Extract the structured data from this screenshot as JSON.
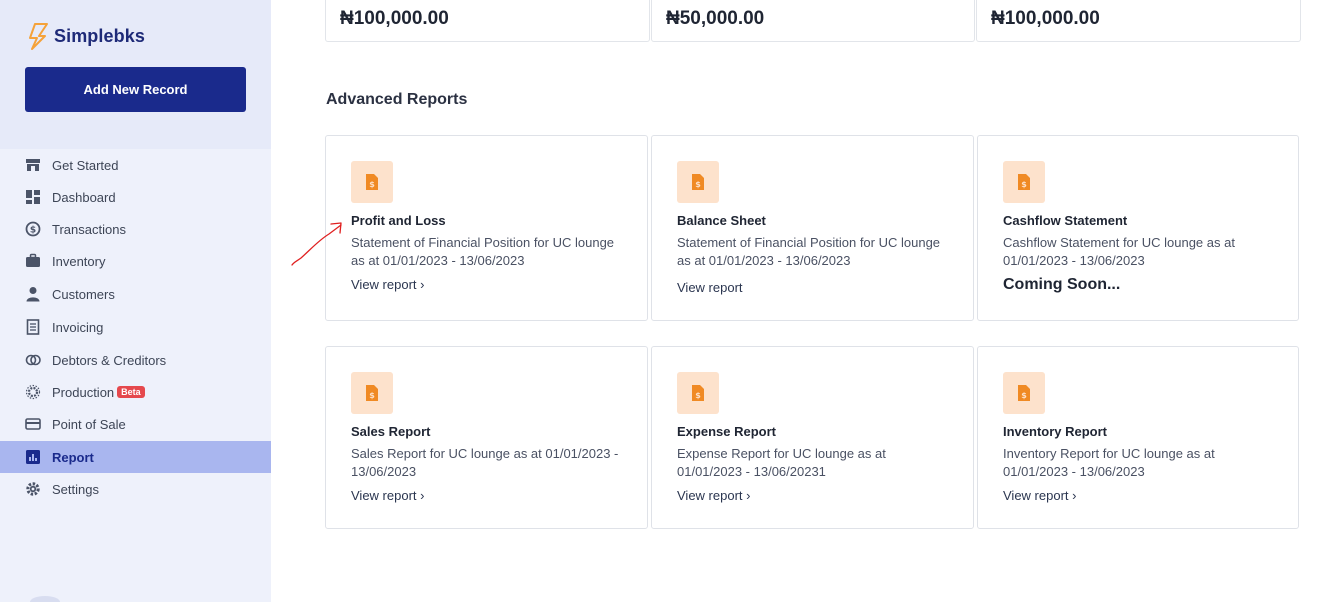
{
  "brand": {
    "name": "Simplebks",
    "icon": "brand-logo-icon",
    "color": "#1e2a78"
  },
  "sidebar": {
    "add_button": "Add New Record",
    "items": [
      {
        "label": "Get Started",
        "icon": "store-icon"
      },
      {
        "label": "Dashboard",
        "icon": "dashboard-icon"
      },
      {
        "label": "Transactions",
        "icon": "transactions-icon"
      },
      {
        "label": "Inventory",
        "icon": "briefcase-icon"
      },
      {
        "label": "Customers",
        "icon": "user-icon"
      },
      {
        "label": "Invoicing",
        "icon": "invoice-icon"
      },
      {
        "label": "Debtors & Creditors",
        "icon": "coins-icon"
      },
      {
        "label": "Production",
        "icon": "gear-cog-icon",
        "badge": "Beta"
      },
      {
        "label": "Point of Sale",
        "icon": "card-icon"
      },
      {
        "label": "Report",
        "icon": "report-icon",
        "active": true
      },
      {
        "label": "Settings",
        "icon": "settings-icon"
      }
    ]
  },
  "summary": [
    {
      "value": "₦100,000.00"
    },
    {
      "value": "₦50,000.00"
    },
    {
      "value": "₦100,000.00"
    }
  ],
  "advanced_reports": {
    "title": "Advanced Reports",
    "cards": [
      {
        "title": "Profit and Loss",
        "description": "Statement of Financial Position for UC lounge as at 01/01/2023 - 13/06/2023",
        "link": "View report ›"
      },
      {
        "title": "Balance Sheet",
        "description": "Statement of Financial Position for UC lounge as at 01/01/2023 - 13/06/2023",
        "link": "View report"
      },
      {
        "title": "Cashflow Statement",
        "description": "Cashflow Statement for UC lounge as at 01/01/2023 - 13/06/2023",
        "status": "Coming Soon..."
      },
      {
        "title": "Sales Report",
        "description": "Sales Report for UC lounge as at 01/01/2023 - 13/06/2023",
        "link": "View report ›"
      },
      {
        "title": "Expense Report",
        "description": "Expense Report for UC lounge as at 01/01/2023 - 13/06/20231",
        "link": "View report ›"
      },
      {
        "title": "Inventory Report",
        "description": "Inventory Report for UC lounge as at 01/01/2023 - 13/06/2023",
        "link": "View report ›"
      }
    ]
  },
  "colors": {
    "accent": "#1a2a8c",
    "active_bg": "#a9b6ef",
    "report_icon_bg": "#fde2cc",
    "report_icon_fg": "#f08a24",
    "annotation": "#e02020"
  }
}
